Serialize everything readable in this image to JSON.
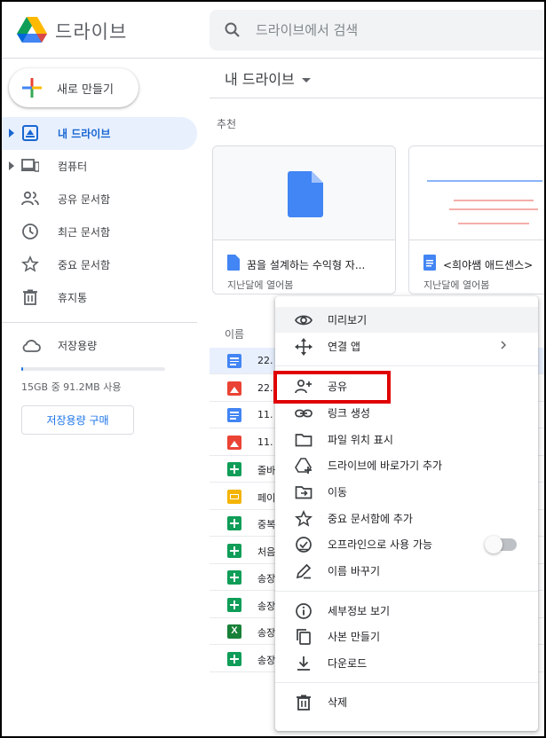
{
  "colors": {
    "accent": "#1a73e8",
    "highlight": "#e00000",
    "active_bg": "#e8f0fe"
  },
  "header": {
    "app_name": "드라이브",
    "search_placeholder": "드라이브에서 검색"
  },
  "sidebar": {
    "new_label": "새로 만들기",
    "items": [
      {
        "label": "내 드라이브",
        "icon": "my-drive-icon",
        "active": true
      },
      {
        "label": "컴퓨터",
        "icon": "computer-icon"
      },
      {
        "label": "공유 문서함",
        "icon": "shared-people-icon"
      },
      {
        "label": "최근 문서함",
        "icon": "clock-icon"
      },
      {
        "label": "중요 문서함",
        "icon": "star-icon"
      },
      {
        "label": "휴지통",
        "icon": "trash-icon"
      }
    ],
    "storage": {
      "label": "저장용량",
      "usage_text": "15GB 중 91.2MB 사용",
      "used_fraction": 0.006,
      "buy_label": "저장용량 구매"
    }
  },
  "main": {
    "title": "내 드라이브",
    "suggested_label": "추천",
    "cards": [
      {
        "name": "꿈을 설계하는 수익형 자...",
        "sub": "지난달에 열어봄"
      },
      {
        "name": "<희야쌤 애드센스>",
        "sub": "지난달에 열어봄"
      }
    ],
    "list_header": "이름",
    "files": [
      {
        "name": "22.",
        "type": "doc"
      },
      {
        "name": "22.",
        "type": "image"
      },
      {
        "name": "11.",
        "type": "doc"
      },
      {
        "name": "11.",
        "type": "image"
      },
      {
        "name": "줄바",
        "type": "sheet"
      },
      {
        "name": "페이",
        "type": "slides"
      },
      {
        "name": "중복",
        "type": "sheet"
      },
      {
        "name": "처음",
        "type": "sheet"
      },
      {
        "name": "송장",
        "type": "sheet"
      },
      {
        "name": "송장",
        "type": "sheet"
      },
      {
        "name": "송장",
        "type": "excel"
      },
      {
        "name": "송장",
        "type": "sheet"
      }
    ]
  },
  "menu": {
    "items": [
      {
        "label": "미리보기",
        "icon": "eye-icon"
      },
      {
        "label": "연결 앱",
        "icon": "move-arrows-icon"
      },
      {
        "label": "공유",
        "icon": "person-add-icon"
      },
      {
        "label": "링크 생성",
        "icon": "link-icon"
      },
      {
        "label": "파일 위치 표시",
        "icon": "folder-icon"
      },
      {
        "label": "드라이브에 바로가기 추가",
        "icon": "add-shortcut-icon"
      },
      {
        "label": "이동",
        "icon": "move-to-folder-icon"
      },
      {
        "label": "중요 문서함에 추가",
        "icon": "star-outline-icon"
      },
      {
        "label": "오프라인으로 사용 가능",
        "icon": "offline-check-icon"
      },
      {
        "label": "이름 바꾸기",
        "icon": "pencil-icon"
      },
      {
        "label": "세부정보 보기",
        "icon": "info-icon"
      },
      {
        "label": "사본 만들기",
        "icon": "copy-icon"
      },
      {
        "label": "다운로드",
        "icon": "download-icon"
      },
      {
        "label": "삭제",
        "icon": "trash-icon"
      }
    ]
  }
}
